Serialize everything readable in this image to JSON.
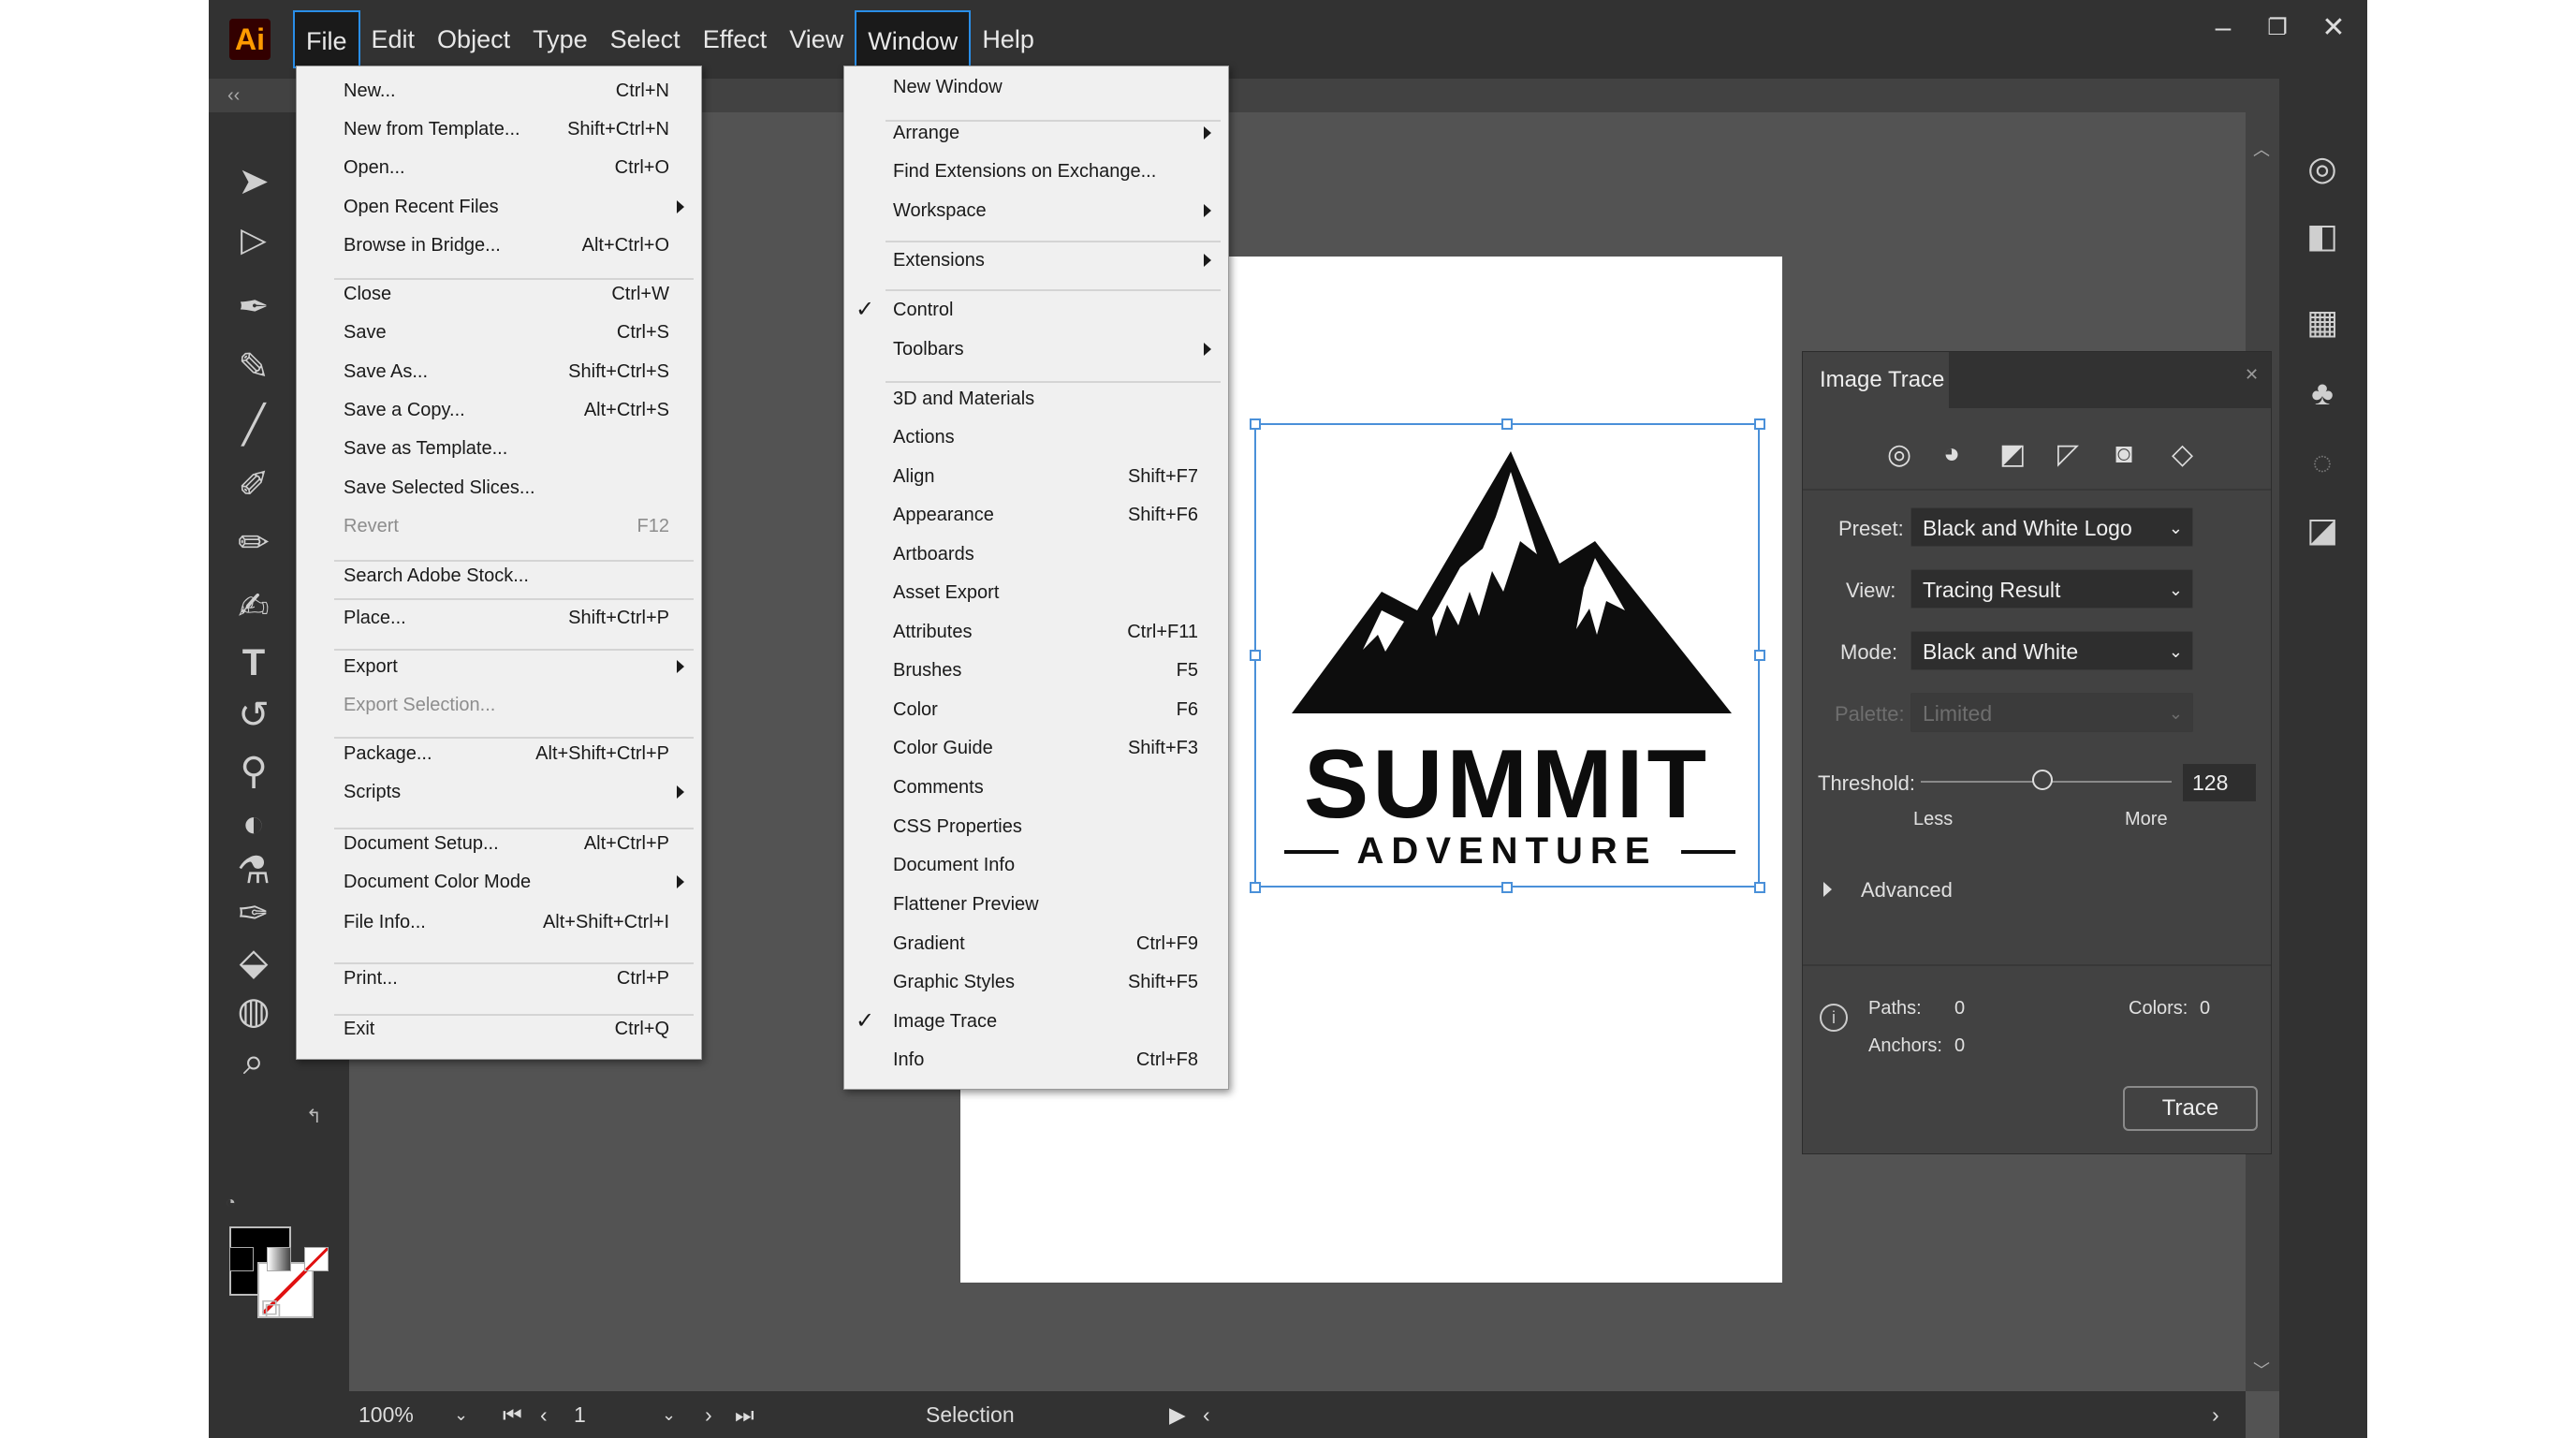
{
  "app": {
    "logo": "Ai"
  },
  "menubar": {
    "items": [
      "File",
      "Edit",
      "Object",
      "Type",
      "Select",
      "Effect",
      "View",
      "Window",
      "Help"
    ]
  },
  "file_menu": {
    "items": [
      {
        "label": "New...",
        "shortcut": "Ctrl+N"
      },
      {
        "label": "New from Template...",
        "shortcut": "Shift+Ctrl+N"
      },
      {
        "label": "Open...",
        "shortcut": "Ctrl+O"
      },
      {
        "label": "Open Recent Files",
        "shortcut": ""
      },
      {
        "label": "Browse in Bridge...",
        "shortcut": "Alt+Ctrl+O"
      },
      {
        "label": "Close",
        "shortcut": "Ctrl+W"
      },
      {
        "label": "Save",
        "shortcut": "Ctrl+S"
      },
      {
        "label": "Save As...",
        "shortcut": "Shift+Ctrl+S"
      },
      {
        "label": "Save a Copy...",
        "shortcut": "Alt+Ctrl+S"
      },
      {
        "label": "Save as Template...",
        "shortcut": ""
      },
      {
        "label": "Save Selected Slices...",
        "shortcut": ""
      },
      {
        "label": "Revert",
        "shortcut": "F12"
      },
      {
        "label": "Search Adobe Stock...",
        "shortcut": ""
      },
      {
        "label": "Place...",
        "shortcut": "Shift+Ctrl+P"
      },
      {
        "label": "Export",
        "shortcut": ""
      },
      {
        "label": "Export Selection...",
        "shortcut": ""
      },
      {
        "label": "Package...",
        "shortcut": "Alt+Shift+Ctrl+P"
      },
      {
        "label": "Scripts",
        "shortcut": ""
      },
      {
        "label": "Document Setup...",
        "shortcut": "Alt+Ctrl+P"
      },
      {
        "label": "Document Color Mode",
        "shortcut": ""
      },
      {
        "label": "File Info...",
        "shortcut": "Alt+Shift+Ctrl+I"
      },
      {
        "label": "Print...",
        "shortcut": "Ctrl+P"
      },
      {
        "label": "Exit",
        "shortcut": "Ctrl+Q"
      }
    ]
  },
  "window_menu": {
    "items": [
      {
        "label": "New Window",
        "shortcut": ""
      },
      {
        "label": "Arrange",
        "shortcut": ""
      },
      {
        "label": "Find Extensions on Exchange...",
        "shortcut": ""
      },
      {
        "label": "Workspace",
        "shortcut": ""
      },
      {
        "label": "Extensions",
        "shortcut": ""
      },
      {
        "label": "Control",
        "shortcut": ""
      },
      {
        "label": "Toolbars",
        "shortcut": ""
      },
      {
        "label": "3D and Materials",
        "shortcut": ""
      },
      {
        "label": "Actions",
        "shortcut": ""
      },
      {
        "label": "Align",
        "shortcut": "Shift+F7"
      },
      {
        "label": "Appearance",
        "shortcut": "Shift+F6"
      },
      {
        "label": "Artboards",
        "shortcut": ""
      },
      {
        "label": "Asset Export",
        "shortcut": ""
      },
      {
        "label": "Attributes",
        "shortcut": "Ctrl+F11"
      },
      {
        "label": "Brushes",
        "shortcut": "F5"
      },
      {
        "label": "Color",
        "shortcut": "F6"
      },
      {
        "label": "Color Guide",
        "shortcut": "Shift+F3"
      },
      {
        "label": "Comments",
        "shortcut": ""
      },
      {
        "label": "CSS Properties",
        "shortcut": ""
      },
      {
        "label": "Document Info",
        "shortcut": ""
      },
      {
        "label": "Flattener Preview",
        "shortcut": ""
      },
      {
        "label": "Gradient",
        "shortcut": "Ctrl+F9"
      },
      {
        "label": "Graphic Styles",
        "shortcut": "Shift+F5"
      },
      {
        "label": "Image Trace",
        "shortcut": ""
      },
      {
        "label": "Info",
        "shortcut": "Ctrl+F8"
      }
    ]
  },
  "artwork": {
    "title": "SUMMIT",
    "subtitle": "ADVENTURE"
  },
  "image_trace": {
    "title": "Image Trace",
    "preset_label": "Preset:",
    "preset_value": "Black and White Logo",
    "view_label": "View:",
    "view_value": "Tracing Result",
    "mode_label": "Mode:",
    "mode_value": "Black and White",
    "palette_label": "Palette:",
    "palette_value": "Limited",
    "threshold_label": "Threshold:",
    "threshold_value": "128",
    "less_label": "Less",
    "more_label": "More",
    "advanced_label": "Advanced",
    "paths_label": "Paths:",
    "paths_value": "0",
    "anchors_label": "Anchors:",
    "anchors_value": "0",
    "colors_label": "Colors:",
    "colors_value": "0",
    "trace_button": "Trace"
  },
  "statusbar": {
    "zoom": "100%",
    "artboard_number": "1",
    "status_text": "Selection"
  },
  "colors": {
    "accent": "#2a8ee8",
    "selection": "#4a90d9"
  }
}
